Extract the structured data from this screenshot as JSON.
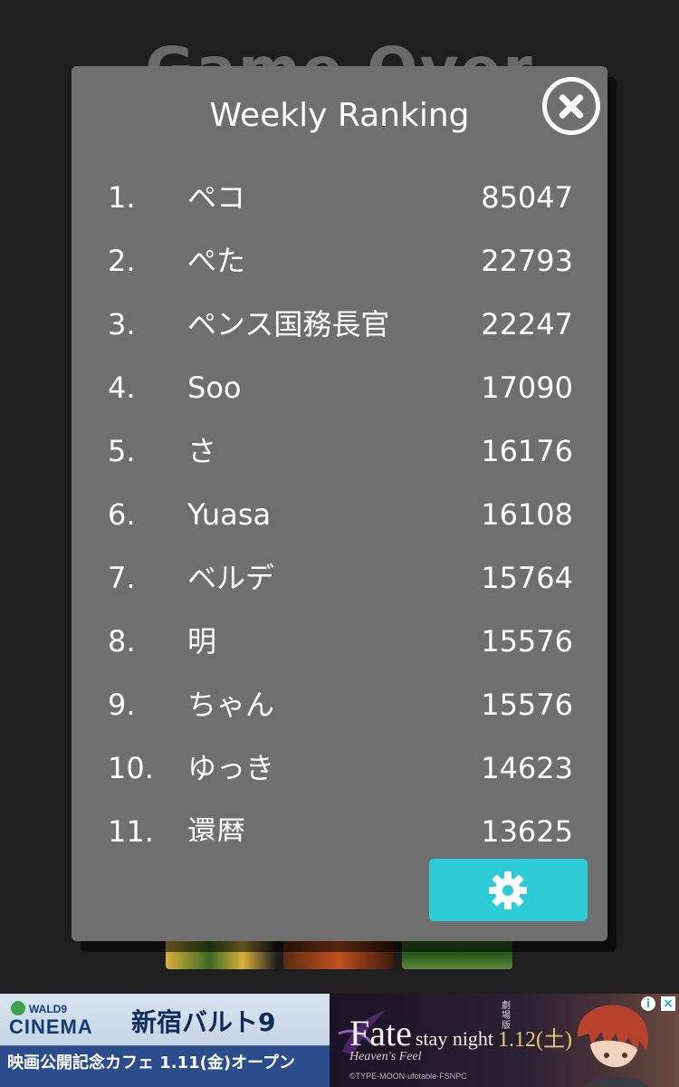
{
  "background": {
    "title": "Game Over"
  },
  "modal": {
    "title": "Weekly Ranking",
    "close_icon": "close-circle-icon",
    "settings_icon": "gear-icon",
    "accent_color": "#2dcbd6",
    "panel_color": "#6f6f6f"
  },
  "ranking": [
    {
      "rank": "1.",
      "name": "ペコ",
      "score": "85047"
    },
    {
      "rank": "2.",
      "name": "ぺた",
      "score": "22793"
    },
    {
      "rank": "3.",
      "name": "ペンス国務長官",
      "score": "22247"
    },
    {
      "rank": "4.",
      "name": "Soo",
      "score": "17090"
    },
    {
      "rank": "5.",
      "name": "さ",
      "score": "16176"
    },
    {
      "rank": "6.",
      "name": "Yuasa",
      "score": "16108"
    },
    {
      "rank": "7.",
      "name": "ベルデ",
      "score": "15764"
    },
    {
      "rank": "8.",
      "name": "明",
      "score": "15576"
    },
    {
      "rank": "9.",
      "name": "ちゃん",
      "score": "15576"
    },
    {
      "rank": "10.",
      "name": "ゆっき",
      "score": "14623"
    },
    {
      "rank": "11.",
      "name": "還暦",
      "score": "13625"
    }
  ],
  "ad": {
    "logo_top": "WALD9",
    "logo_bottom": "CINEMA",
    "venue": "新宿バルト9",
    "cafe_text": "映画公開記念カフェ 1.11(金)オープン",
    "movie_title_big": "Fate",
    "movie_title_small": "stay night",
    "movie_subtitle": "Heaven's Feel",
    "release_label": "劇場版",
    "release_date": "1.12(土)",
    "copyright": "©TYPE-MOON·ufotable·FSNPC",
    "info_icon": "i",
    "close_icon": "×"
  }
}
